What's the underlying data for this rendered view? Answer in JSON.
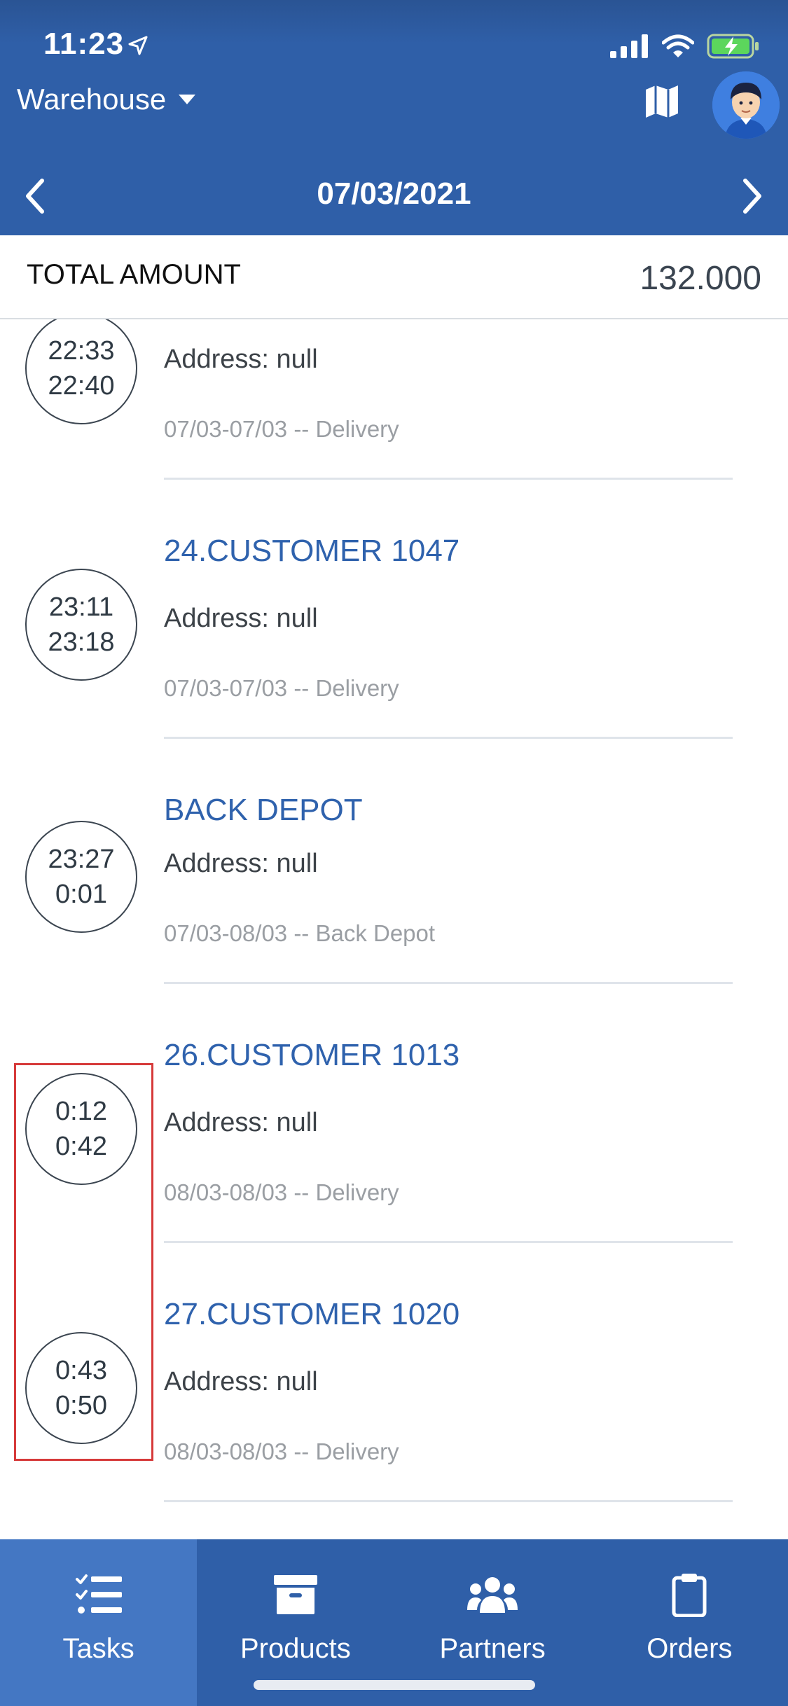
{
  "status": {
    "time": "11:23"
  },
  "header": {
    "warehouse_label": "Warehouse",
    "date": "07/03/2021"
  },
  "total": {
    "label": "TOTAL AMOUNT",
    "value": "132.000"
  },
  "items": [
    {
      "start": "22:33",
      "end": "22:40",
      "name": "",
      "address": "Address: null",
      "meta": "07/03-07/03 -- Delivery"
    },
    {
      "start": "23:11",
      "end": "23:18",
      "name": "24.CUSTOMER 1047",
      "address": "Address: null",
      "meta": "07/03-07/03 -- Delivery"
    },
    {
      "start": "23:27",
      "end": "0:01",
      "name": "BACK DEPOT",
      "address": "Address: null",
      "meta": "07/03-08/03 -- Back Depot"
    },
    {
      "start": "0:12",
      "end": "0:42",
      "name": "26.CUSTOMER 1013",
      "address": "Address: null",
      "meta": "08/03-08/03 -- Delivery"
    },
    {
      "start": "0:43",
      "end": "0:50",
      "name": "27.CUSTOMER 1020",
      "address": "Address: null",
      "meta": "08/03-08/03 -- Delivery"
    }
  ],
  "tabs": [
    {
      "label": "Tasks",
      "icon": "tasks-icon",
      "active": true
    },
    {
      "label": "Products",
      "icon": "box-icon",
      "active": false
    },
    {
      "label": "Partners",
      "icon": "users-icon",
      "active": false
    },
    {
      "label": "Orders",
      "icon": "clipboard-icon",
      "active": false
    }
  ],
  "colors": {
    "header_bg": "#2f5fa8",
    "accent": "#2f62ad",
    "highlight": "#d63a3a",
    "active_tab": "#4477c3"
  }
}
